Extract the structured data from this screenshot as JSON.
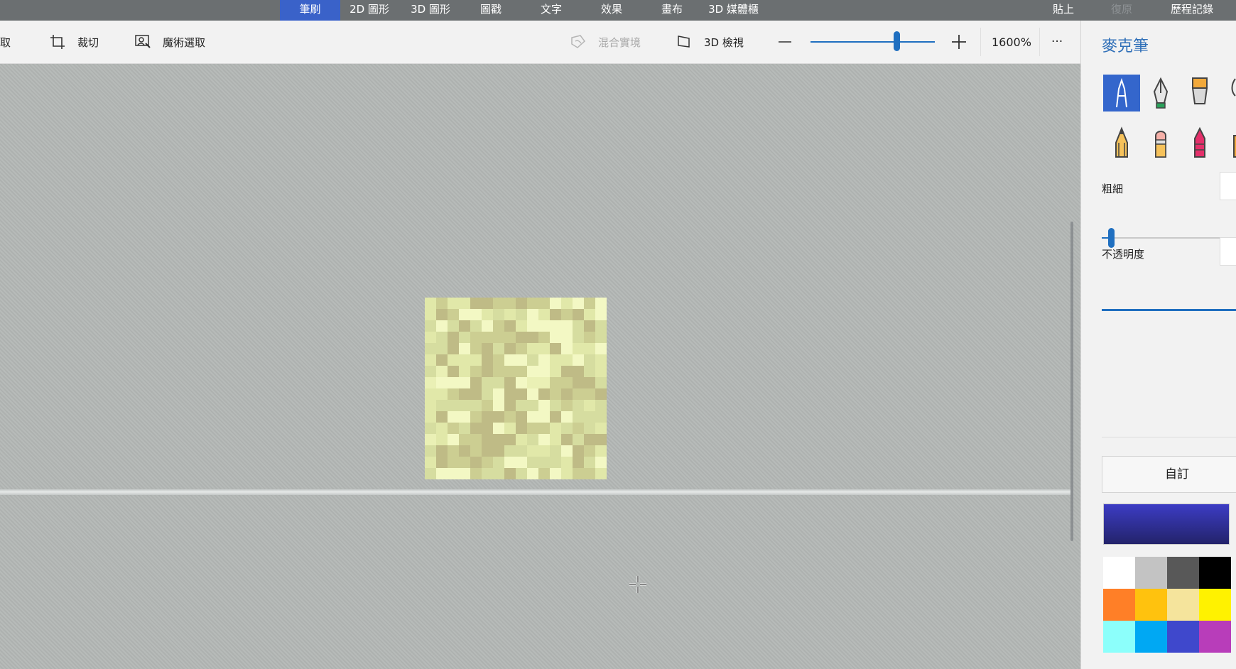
{
  "menu_tabs": [
    "筆刷",
    "2D 圖形",
    "3D 圖形",
    "圖戳",
    "文字",
    "效果",
    "畫布",
    "3D 媒體櫃"
  ],
  "active_tab": "筆刷",
  "menu_right": {
    "paste": "貼上",
    "undo": "復原",
    "history": "歷程記錄"
  },
  "toolbar": {
    "select": "選取",
    "crop": "裁切",
    "magic_select": "魔術選取",
    "mixed_reality": "混合實境",
    "view_3d": "3D 檢視",
    "zoom": "1600%",
    "more": "···"
  },
  "zoom_level_fraction": 0.72,
  "panel": {
    "title": "麥克筆",
    "thickness_label": "粗細",
    "opacity_label": "不透明度",
    "custom_label": "自訂",
    "brushes": [
      "marker-icon",
      "calligraphy-pen-icon",
      "oil-brush-icon",
      "watercolor-icon",
      "pencil-icon",
      "eraser-icon",
      "crayon-icon",
      "pixel-pen-icon"
    ],
    "selected_brush": "marker-icon",
    "current_color": "#3c3cc4",
    "palette": [
      [
        "#ffffff",
        "#c3c3c3",
        "#585858",
        "#000000"
      ],
      [
        "#ff7f27",
        "#ffc20e",
        "#f5e49c",
        "#fff200"
      ],
      [
        "#8cfffb",
        "#00a8f3",
        "#3f48cc",
        "#b83dba"
      ]
    ]
  },
  "canvas_pixels": {
    "colors": [
      "#f3f8c4",
      "#e1e8a9",
      "#ccce92",
      "#bfbb86",
      "#d6dda0",
      "#eaf0b5"
    ],
    "grid": [
      "1211332232201020",
      "1320014140132310",
      "4043402310000434",
      "1434222233200424",
      "4430234321130110",
      "1311132004011041",
      "4531232220013341",
      "5000344305522334",
      "1123340330323223",
      "1444420344042414",
      "1300233230030444",
      "4124330132214241",
      "5102233314013433",
      "4323233441140321",
      "1322324004441340",
      "4000244340201221"
    ]
  }
}
